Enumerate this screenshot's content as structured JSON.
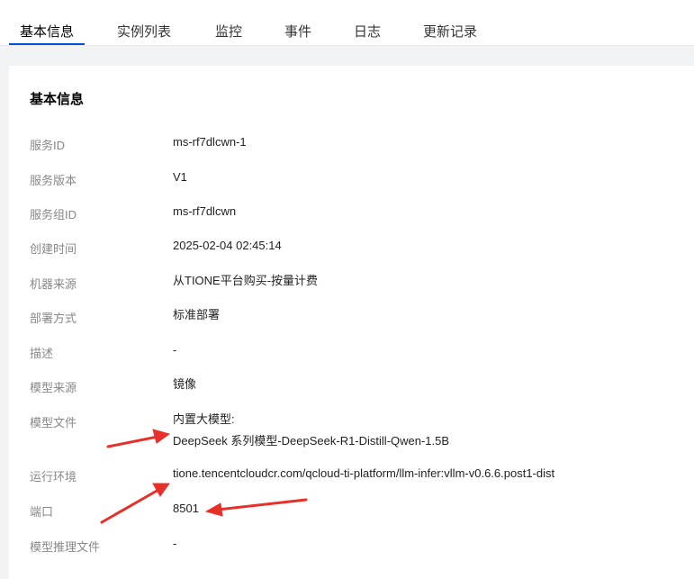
{
  "tabs": [
    "基本信息",
    "实例列表",
    "监控",
    "事件",
    "日志",
    "更新记录"
  ],
  "card_title": "基本信息",
  "rows": [
    {
      "label": "服务ID",
      "value": "ms-rf7dlcwn-1"
    },
    {
      "label": "服务版本",
      "value": "V1"
    },
    {
      "label": "服务组ID",
      "value": "ms-rf7dlcwn"
    },
    {
      "label": "创建时间",
      "value": "2025-02-04 02:45:14"
    },
    {
      "label": "机器来源",
      "value": "从TIONE平台购买-按量计费"
    },
    {
      "label": "部署方式",
      "value": "标准部署"
    },
    {
      "label": "描述",
      "value": "-"
    },
    {
      "label": "模型来源",
      "value": "镜像"
    },
    {
      "label": "模型文件",
      "value": "内置大模型:",
      "value2": "DeepSeek 系列模型-DeepSeek-R1-Distill-Qwen-1.5B"
    },
    {
      "label": "运行环境",
      "value": "tione.tencentcloudcr.com/qcloud-ti-platform/llm-infer:vllm-v0.6.6.post1-dist"
    },
    {
      "label": "端口",
      "value": "8501"
    },
    {
      "label": "模型推理文件",
      "value": "-"
    }
  ],
  "colors": {
    "accent": "#0052d9",
    "arrow": "#e8302a"
  }
}
